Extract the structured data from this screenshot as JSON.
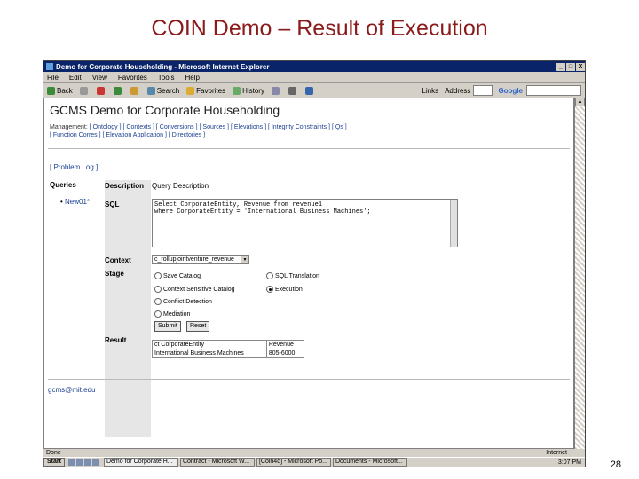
{
  "slide": {
    "title": "COIN Demo – Result of Execution",
    "page_number": "28"
  },
  "browser": {
    "title": "Demo for Corporate Householding - Microsoft Internet Explorer",
    "window_buttons": [
      "_",
      "□",
      "X"
    ],
    "menu": [
      "File",
      "Edit",
      "View",
      "Favorites",
      "Tools",
      "Help"
    ],
    "toolbar": {
      "back": "Back",
      "search": "Search",
      "favorites": "Favorites",
      "history": "History",
      "links": "Links",
      "address": "Address",
      "google": "Google"
    }
  },
  "page": {
    "heading": "GCMS Demo for Corporate Householding",
    "management_label": "Management:",
    "management_links": [
      "[ Ontology ]",
      "[ Contexts ]",
      "[ Conversions ]",
      "[ Sources ]",
      "[ Elevations ]",
      "[ Integrity Constraints ]",
      "[ Qs ]",
      "[ Function Corres ]",
      "[ Elevation Application ]",
      "[ Directories ]"
    ],
    "problem_link": "[ Problem Log ]",
    "queries_label": "Queries",
    "query_item": "New01*",
    "description_label": "Description",
    "description_value": "Query Description",
    "sql_label": "SQL",
    "sql_text": "Select CorporateEntity, Revenue from revenue1\nwhere CorporateEntity = 'International Business Machines';",
    "context_label": "Context",
    "context_value": "c_rollupjointventure_revenue",
    "stage_label": "Stage",
    "stages": [
      {
        "label": "Save Catalog",
        "selected": false
      },
      {
        "label": "SQL Translation",
        "selected": false
      },
      {
        "label": "Context Sensitive Catalog",
        "selected": false
      },
      {
        "label": "Execution",
        "selected": true
      },
      {
        "label": "Conflict Detection",
        "selected": false
      },
      {
        "label": "Mediation",
        "selected": false
      }
    ],
    "submit_label": "Submit",
    "reset_label": "Reset",
    "result_label": "Result",
    "result_headers": [
      "ct CorporateEntity",
      "Revenue"
    ],
    "result_rows": [
      [
        "International Business Machines",
        "805-6000"
      ]
    ],
    "email": "gcms@mit.edu"
  },
  "status": {
    "text": "Done",
    "zone": "Internet"
  },
  "taskbar": {
    "start": "Start",
    "tasks": [
      "Demo for Corporate H...",
      "Contract - Microsoft W...",
      "[Coin4d] - Microsoft Po...",
      "Documents - Microsoft..."
    ],
    "clock": "3:07 PM"
  },
  "colors": {
    "title": "#8b1a1a",
    "ie_titlebar": "#0a246a",
    "link": "#1a3e8f"
  }
}
